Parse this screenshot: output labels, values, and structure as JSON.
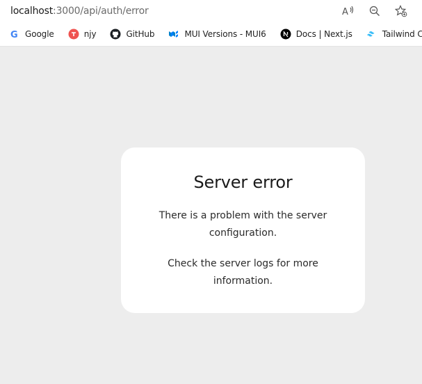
{
  "browser": {
    "url_host": "localhost",
    "url_path": ":3000/api/auth/error",
    "address_icons": [
      "read-aloud-icon",
      "zoom-icon",
      "favorite-add-icon"
    ],
    "bookmarks": [
      {
        "label": "Google",
        "icon": "google-icon"
      },
      {
        "label": "njy",
        "icon": "njy-icon"
      },
      {
        "label": "GitHub",
        "icon": "github-icon"
      },
      {
        "label": "MUI Versions - MUI6",
        "icon": "mui-icon"
      },
      {
        "label": "Docs | Next.js",
        "icon": "nextjs-icon"
      },
      {
        "label": "Tailwind CSS",
        "icon": "tailwind-icon"
      }
    ]
  },
  "card": {
    "title": "Server error",
    "message_1": "There is a problem with the server configuration.",
    "message_2": "Check the server logs for more information."
  },
  "colors": {
    "page_background": "#ededed",
    "card_background": "#ffffff",
    "chrome_background": "#ffffff"
  }
}
